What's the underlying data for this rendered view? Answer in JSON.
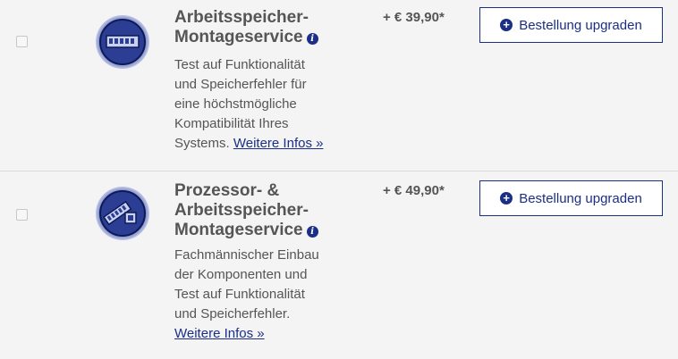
{
  "services": [
    {
      "title_lines": [
        "Arbeitsspeicher-",
        "Montageservice"
      ],
      "desc_lines": [
        "Test auf Funktionalität",
        "und Speicherfehler für",
        "eine höchstmögliche",
        "Kompatibilität Ihres"
      ],
      "desc_last": "Systems.",
      "link_label": "Weitere Infos »",
      "price": "+ € 39,90*",
      "button_label": "Bestellung upgraden",
      "icon": "ram-icon"
    },
    {
      "title_lines": [
        "Prozessor- &",
        "Arbeitsspeicher-",
        "Montageservice"
      ],
      "desc_lines": [
        "Fachmännischer Einbau",
        "der Komponenten und",
        "Test auf Funktionalität",
        "und Speicherfehler."
      ],
      "link_label": "Weitere Infos »",
      "price": "+ € 49,90*",
      "button_label": "Bestellung upgraden",
      "icon": "cpu-ram-icon"
    }
  ],
  "info_glyph": "i",
  "plus_glyph": "+",
  "colors": {
    "accent": "#1b2f86",
    "background": "#f4f4f4",
    "text": "#555555"
  }
}
